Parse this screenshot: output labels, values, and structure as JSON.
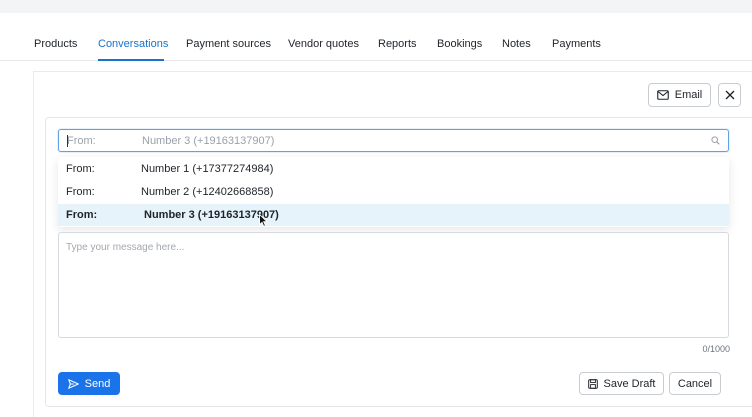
{
  "tabs": [
    {
      "label": "Products"
    },
    {
      "label": "Conversations"
    },
    {
      "label": "Payment sources"
    },
    {
      "label": "Vendor quotes"
    },
    {
      "label": "Reports"
    },
    {
      "label": "Bookings"
    },
    {
      "label": "Notes"
    },
    {
      "label": "Payments"
    }
  ],
  "active_tab": "Conversations",
  "header": {
    "email_label": "Email"
  },
  "from_select": {
    "label": "From:",
    "value_placeholder": "Number 3 (+19163137907)"
  },
  "dropdown": {
    "options": [
      {
        "key": "From:",
        "value": "Number 1 (+17377274984)"
      },
      {
        "key": "From:",
        "value": "Number 2 (+12402668858)"
      },
      {
        "key": "From:",
        "value": "Number 3 (+19163137907)"
      }
    ],
    "selected_index": 2
  },
  "message": {
    "placeholder": "Type your message here...",
    "counter": "0/1000"
  },
  "footer": {
    "send_label": "Send",
    "save_draft_label": "Save Draft",
    "cancel_label": "Cancel"
  },
  "colors": {
    "accent": "#1a73c9",
    "primary_button": "#1a73e8",
    "selected_option_bg": "#e6f3fb"
  },
  "icons": {
    "email": "mail-icon",
    "close": "close-icon",
    "search": "search-icon",
    "send": "send-icon",
    "save": "save-icon"
  }
}
